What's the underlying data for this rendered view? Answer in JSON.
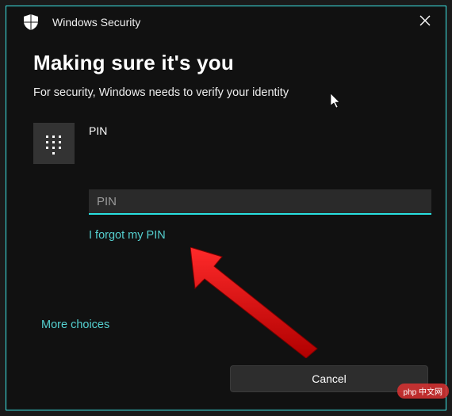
{
  "window": {
    "title": "Windows Security"
  },
  "heading": "Making sure it's you",
  "subtext": "For security, Windows needs to verify your identity",
  "pin": {
    "label": "PIN",
    "placeholder": "PIN",
    "value": ""
  },
  "links": {
    "forgot": "I forgot my PIN",
    "more_choices": "More choices"
  },
  "buttons": {
    "cancel": "Cancel"
  },
  "colors": {
    "accent": "#29e0e0",
    "link": "#55d0d0",
    "bg": "#111111"
  },
  "watermark": "php 中文网"
}
